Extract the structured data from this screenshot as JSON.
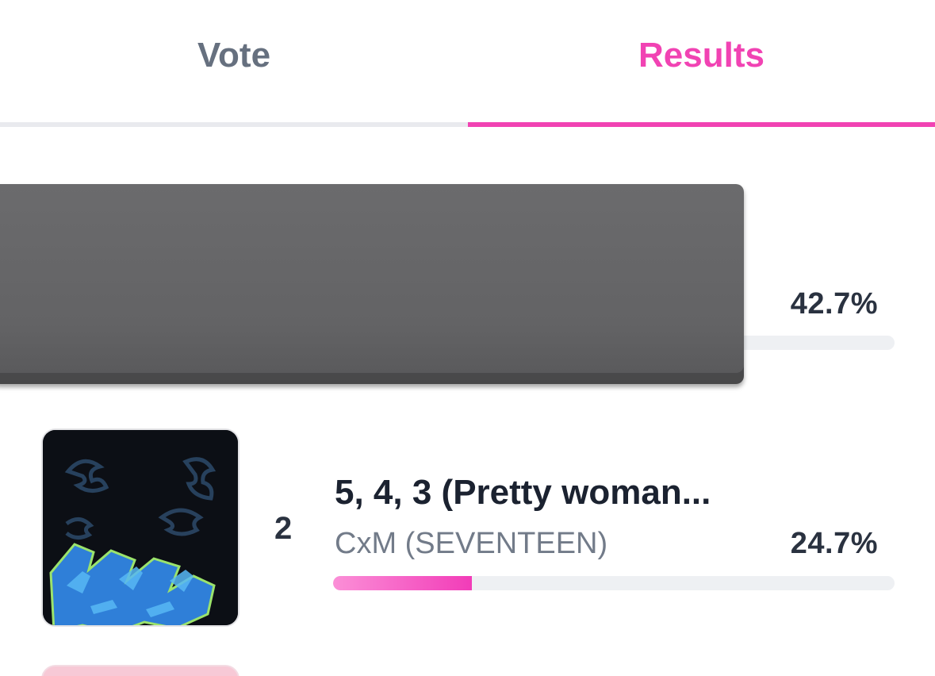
{
  "tabs": {
    "vote_label": "Vote",
    "results_label": "Results",
    "active": "results"
  },
  "colors": {
    "accent": "#f143b3",
    "inactive_tab": "#66707f"
  },
  "results": [
    {
      "percent_label": "42.7%",
      "percent": 42.7
    },
    {
      "rank": "2",
      "title": "5, 4, 3 (Pretty woman...",
      "artist": "CxM (SEVENTEEN)",
      "percent_label": "24.7%",
      "percent": 24.7,
      "cover_icon": "album-cover-graffiti-art"
    }
  ]
}
